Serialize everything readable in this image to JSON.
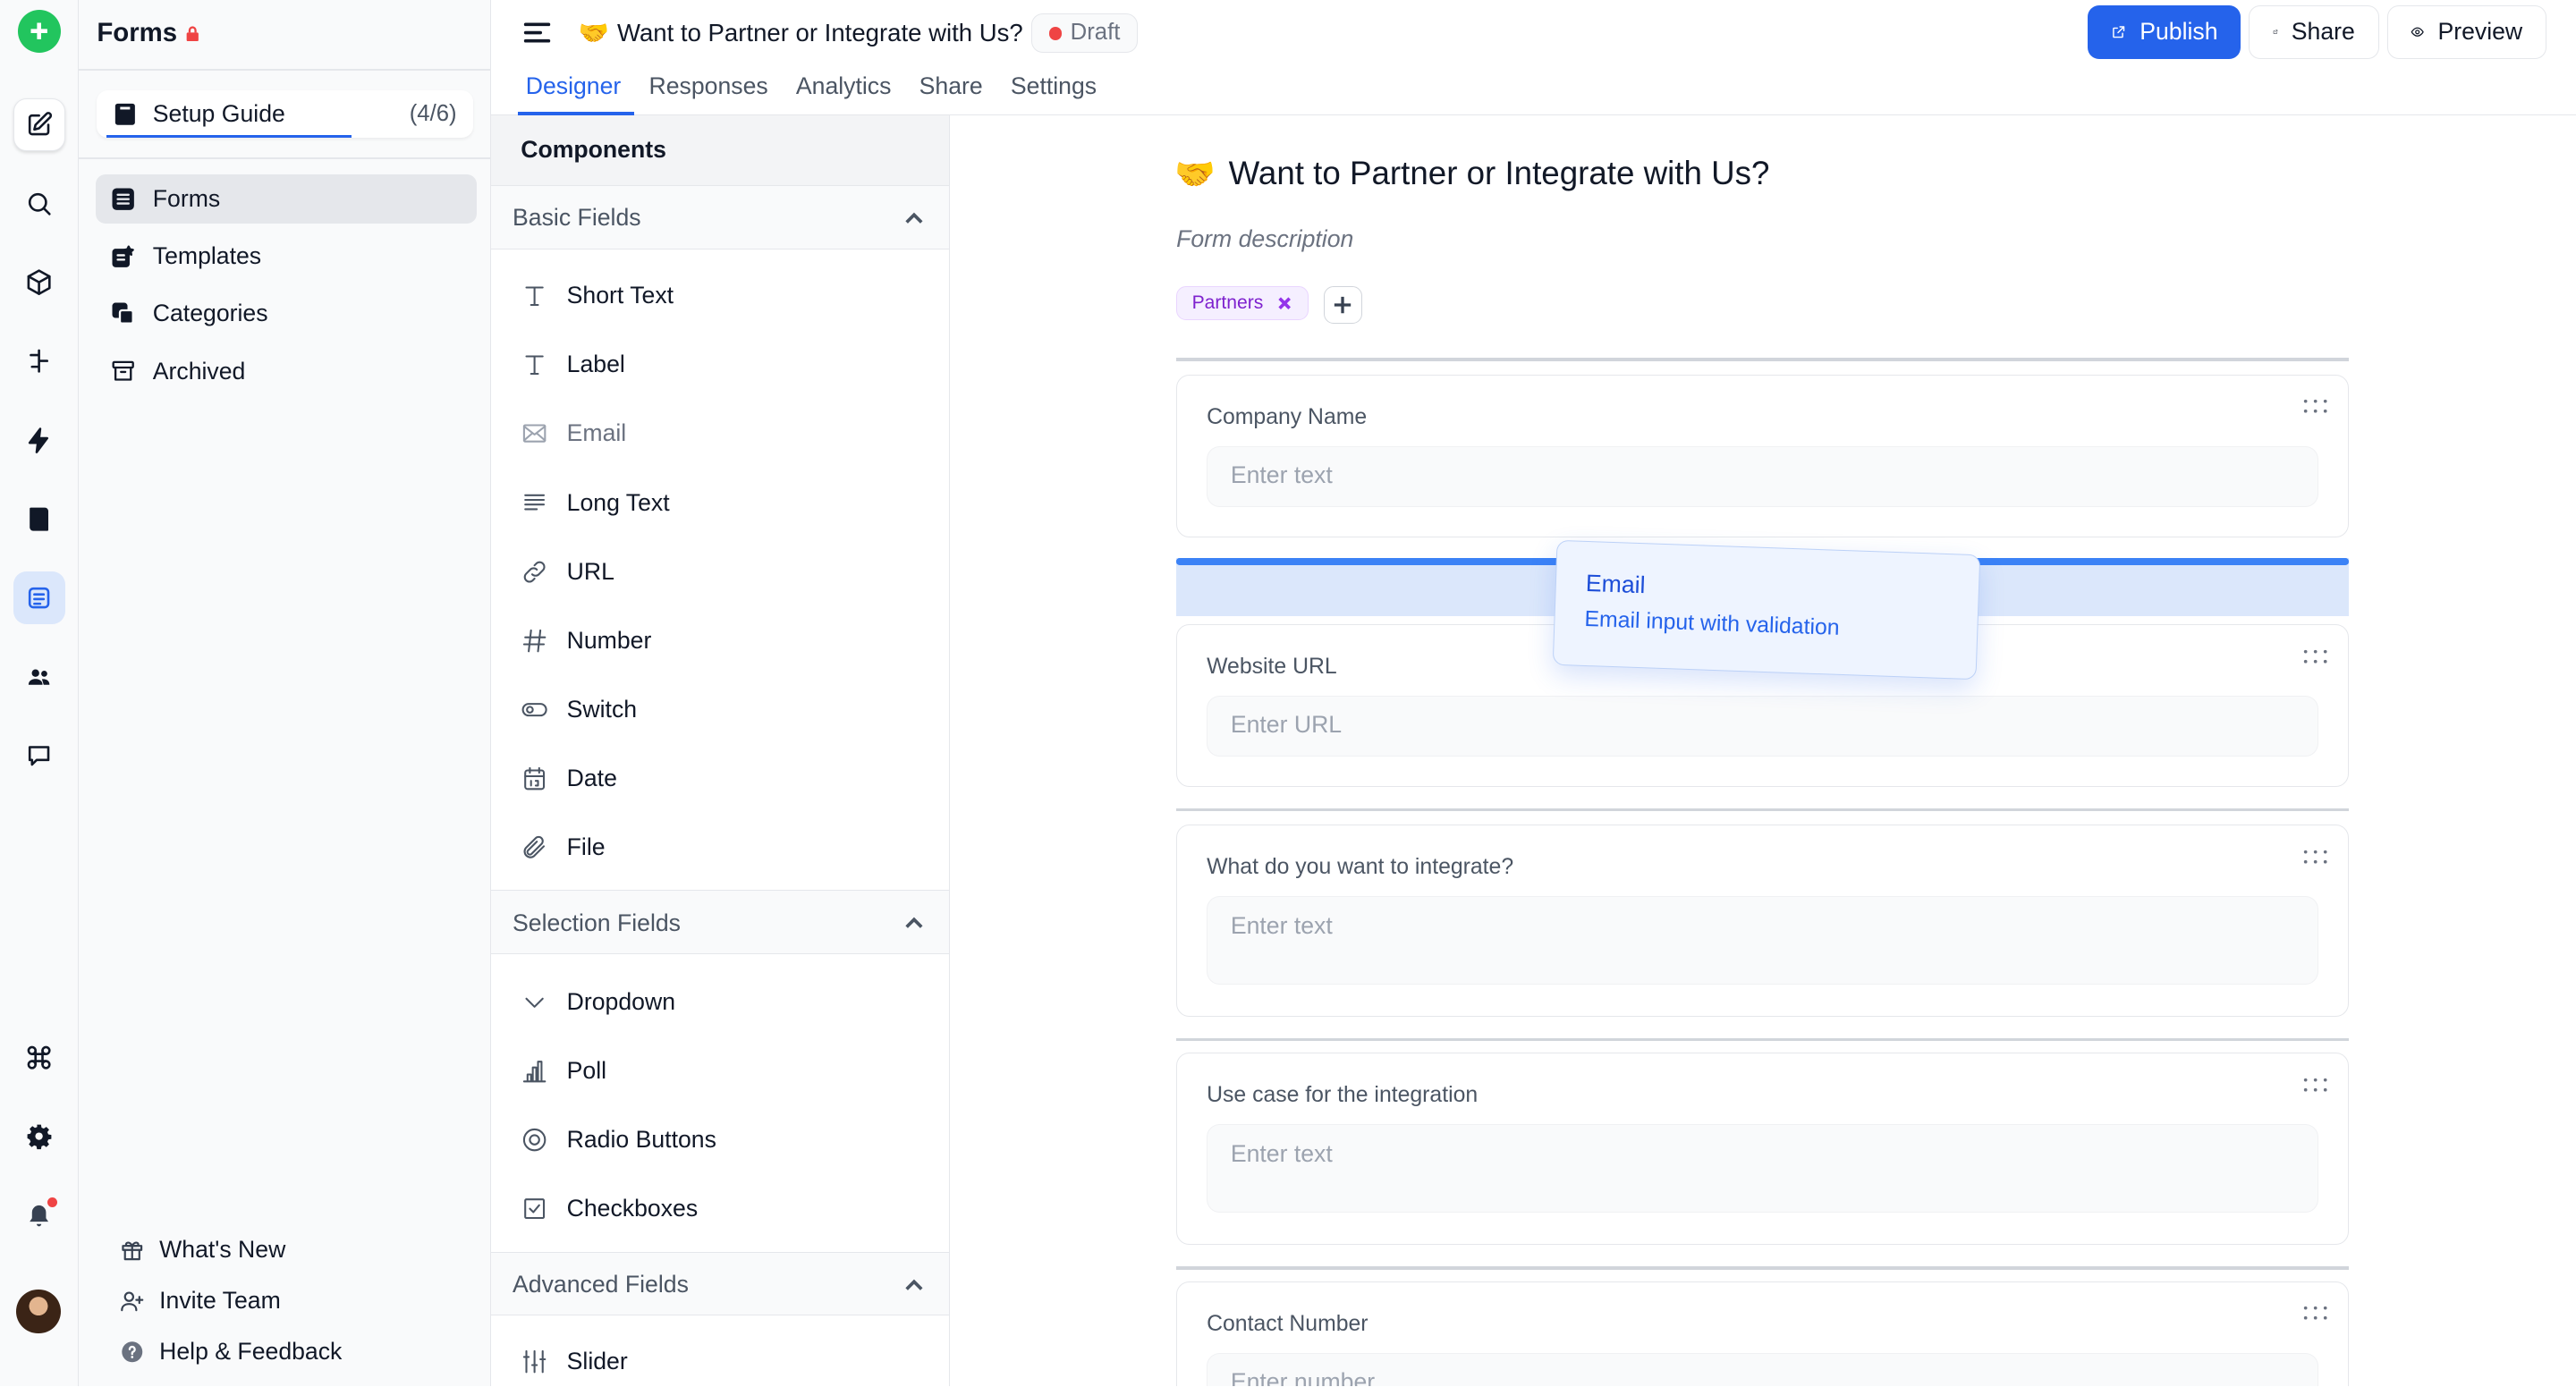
{
  "sidebar": {
    "title": "Forms",
    "setup_guide": {
      "label": "Setup Guide",
      "count": "(4/6)"
    },
    "nav": [
      "Forms",
      "Templates",
      "Categories",
      "Archived"
    ],
    "footer": [
      "What's New",
      "Invite Team",
      "Help & Feedback"
    ]
  },
  "header": {
    "emoji": "🤝",
    "title": "Want to Partner or Integrate with Us?",
    "status": "Draft",
    "publish": "Publish",
    "share": "Share",
    "preview": "Preview",
    "tabs": [
      "Designer",
      "Responses",
      "Analytics",
      "Share",
      "Settings"
    ]
  },
  "components": {
    "title": "Components",
    "basic": {
      "label": "Basic Fields",
      "items": [
        "Short Text",
        "Label",
        "Email",
        "Long Text",
        "URL",
        "Number",
        "Switch",
        "Date",
        "File"
      ]
    },
    "selection": {
      "label": "Selection Fields",
      "items": [
        "Dropdown",
        "Poll",
        "Radio Buttons",
        "Checkboxes"
      ]
    },
    "advanced": {
      "label": "Advanced Fields",
      "items": [
        "Slider"
      ]
    }
  },
  "form": {
    "title": "Want to Partner or Integrate with Us?",
    "description": "Form description",
    "tag": "Partners",
    "fields": [
      {
        "label": "Company Name",
        "placeholder": "Enter text"
      },
      {
        "label": "Website URL",
        "placeholder": "Enter URL"
      },
      {
        "label": "What do you want to integrate?",
        "placeholder": "Enter text"
      },
      {
        "label": "Use case for the integration",
        "placeholder": "Enter text"
      },
      {
        "label": "Contact Number",
        "placeholder": "Enter number"
      }
    ]
  },
  "drag_ghost": {
    "title": "Email",
    "subtitle": "Email input with validation"
  },
  "colors": {
    "accent": "#2563eb",
    "add": "#22c55e",
    "draft_dot": "#ef4444",
    "tag": "#7e22ce"
  }
}
